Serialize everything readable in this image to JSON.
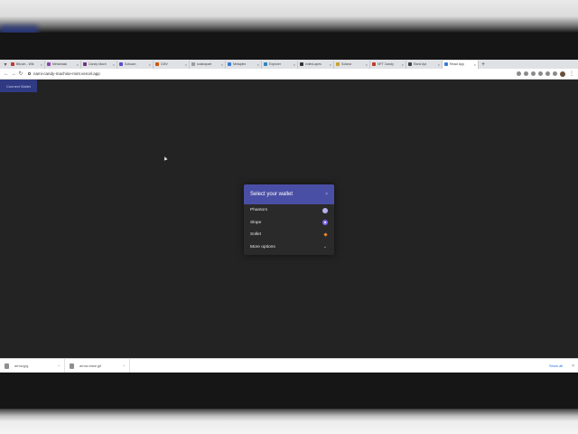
{
  "browser": {
    "tabs": [
      {
        "label": "Bitcoin - Wik",
        "color": "#c0392b"
      },
      {
        "label": "Metamask",
        "color": "#8e44ad"
      },
      {
        "label": "Candy Mach",
        "color": "#6c3483"
      },
      {
        "label": "Solscan",
        "color": "#5b4bd1"
      },
      {
        "label": "CMV",
        "color": "#d35400"
      },
      {
        "label": "solanapart",
        "color": "#9c9c9c"
      },
      {
        "label": "Metaplex",
        "color": "#3a7bd5"
      },
      {
        "label": "Explorer",
        "color": "#2e86c1"
      },
      {
        "label": "exiled-apes",
        "color": "#333333"
      },
      {
        "label": "Solana",
        "color": "#c9a227"
      },
      {
        "label": "NFT Candy",
        "color": "#c0392b"
      },
      {
        "label": "Rand Api",
        "color": "#444444"
      },
      {
        "label": "React App",
        "color": "#3a7bd5"
      }
    ],
    "url": "nami-candy-machine-mint.vercel.app"
  },
  "page": {
    "connect_button": "Connect Wallet"
  },
  "modal": {
    "title": "Select your wallet",
    "close": "×",
    "wallets": [
      {
        "label": "Phantom",
        "icon": "phantom-icon"
      },
      {
        "label": "Slope",
        "icon": "slope-icon"
      },
      {
        "label": "Sollet",
        "icon": "sollet-icon"
      },
      {
        "label": "More options",
        "icon": "chevron-down-icon"
      }
    ]
  },
  "downloads": {
    "items": [
      {
        "name": "arrow.jpg"
      },
      {
        "name": "arrow-ease.gif"
      }
    ],
    "show_all": "Show all"
  }
}
